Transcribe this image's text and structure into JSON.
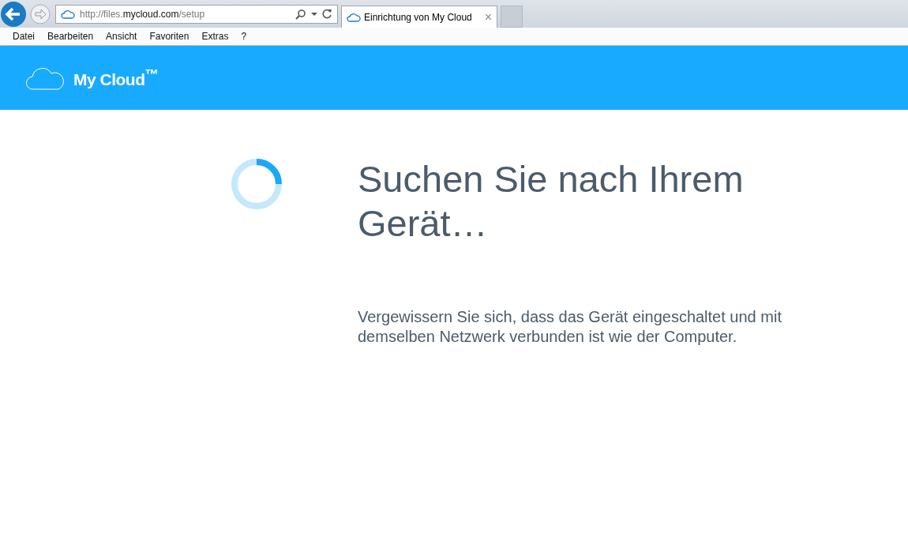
{
  "browser": {
    "address": {
      "prefix": "http://files.",
      "domain": "mycloud.com",
      "path": "/setup"
    },
    "tabs": [
      {
        "title": "Einrichtung von My Cloud",
        "selected": true
      }
    ],
    "close_glyph": "×"
  },
  "menu": [
    "Datei",
    "Bearbeiten",
    "Ansicht",
    "Favoriten",
    "Extras",
    "?"
  ],
  "header": {
    "logo_text": "My Cloud$^{™}$"
  },
  "main": {
    "heading": "Suchen Sie nach Ihrem Gerät…",
    "message": "Vergewissern Sie sich, dass das Gerät eingeschaltet und mit demselben Netzwerk verbunden ist wie der Computer."
  }
}
